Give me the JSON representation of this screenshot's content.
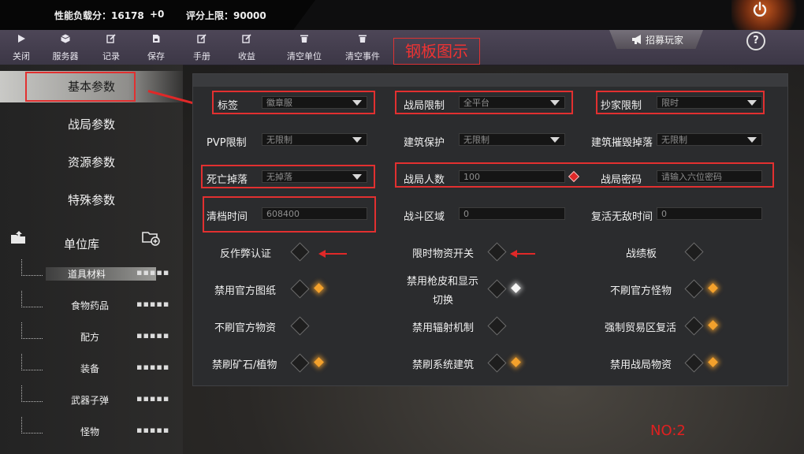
{
  "stats": {
    "load_label": "性能负载分：16178",
    "delta": "+0",
    "limit_label": "评分上限：90000"
  },
  "toolbar": {
    "items": [
      {
        "label": "关闭",
        "icon": "play-icon"
      },
      {
        "label": "服务器",
        "icon": "cube-icon"
      },
      {
        "label": "记录",
        "icon": "edit-icon"
      },
      {
        "label": "保存",
        "icon": "save-icon"
      },
      {
        "label": "手册",
        "icon": "edit-icon"
      },
      {
        "label": "收益",
        "icon": "edit-icon"
      },
      {
        "label": "清空单位",
        "icon": "trash-icon"
      },
      {
        "label": "清空事件",
        "icon": "trash-icon"
      }
    ],
    "plate_label": "钢板图示",
    "recruit_label": "招募玩家",
    "help_label": "?"
  },
  "sidebar": {
    "items": [
      "基本参数",
      "战局参数",
      "资源参数",
      "特殊参数"
    ],
    "unit_lib": "单位库",
    "tree": [
      "道具材料",
      "食物药品",
      "配方",
      "装备",
      "武器子弹",
      "怪物"
    ],
    "tree_dots": "▪▪▪▪▪"
  },
  "form": {
    "tag_label": "标签",
    "tag_value": "徽章服",
    "match_limit_label": "战局限制",
    "match_limit_value": "全平台",
    "raid_limit_label": "抄家限制",
    "raid_limit_value": "限时",
    "pvp_label": "PVP限制",
    "pvp_value": "无限制",
    "build_protect_label": "建筑保护",
    "build_protect_value": "无限制",
    "build_drop_label": "建筑摧毁掉落",
    "build_drop_value": "无限制",
    "death_drop_label": "死亡掉落",
    "death_drop_value": "无掉落",
    "players_label": "战局人数",
    "players_value": "100",
    "password_label": "战局密码",
    "password_placeholder": "请输入六位密码",
    "wipe_label": "清档时间",
    "wipe_value": "608400",
    "combat_zone_label": "战斗区域",
    "combat_zone_value": "0",
    "revive_label": "复活无敌时间",
    "revive_value": "0"
  },
  "toggles": [
    {
      "label": "反作弊认证",
      "star": ""
    },
    {
      "label": "限时物资开关",
      "star": ""
    },
    {
      "label": "战绩板",
      "star": ""
    },
    {
      "label": "禁用官方图纸",
      "star": "orange"
    },
    {
      "label": "禁用枪皮和显示",
      "label2": "切换",
      "star": "white"
    },
    {
      "label": "不刷官方怪物",
      "star": "orange"
    },
    {
      "label": "不刷官方物资",
      "star": ""
    },
    {
      "label": "禁用辐射机制",
      "star": ""
    },
    {
      "label": "强制贸易区复活",
      "star": "orange"
    },
    {
      "label": "禁刷矿石/植物",
      "star": "orange"
    },
    {
      "label": "禁刷系统建筑",
      "star": "orange"
    },
    {
      "label": "禁用战局物资",
      "star": "orange"
    }
  ],
  "footer": {
    "no_label": "NO:2"
  },
  "colors": {
    "highlight": "#e23030",
    "star_orange": "#f3a12c"
  }
}
